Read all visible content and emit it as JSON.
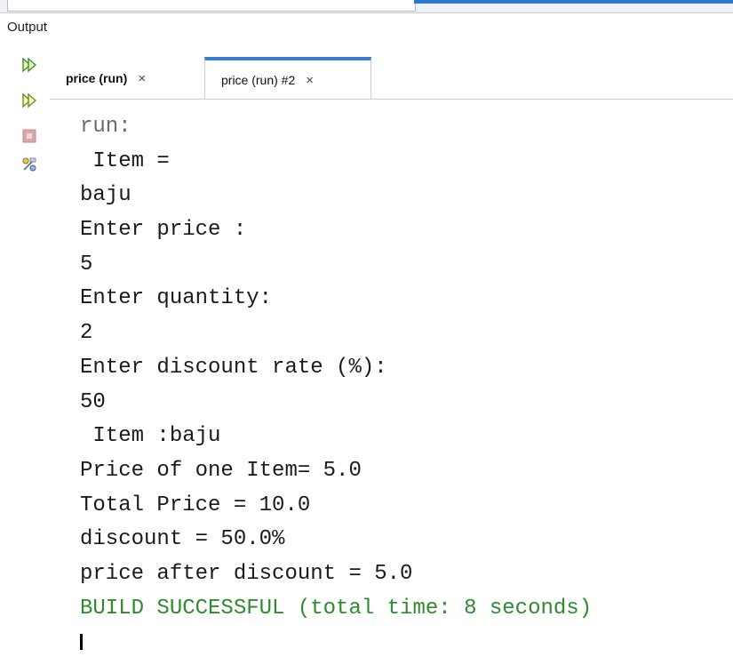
{
  "window": {
    "panel_title": "Output"
  },
  "tabs": [
    {
      "label": "price (run)",
      "close": "×",
      "active": false
    },
    {
      "label": "price (run) #2",
      "close": "×",
      "active": true
    }
  ],
  "toolbar": {
    "rerun_icon": "rerun-icon",
    "rerun_different_icon": "rerun-with-different-params-icon",
    "stop_icon": "stop-icon",
    "settings_icon": "settings-icon",
    "colors": {
      "accent": "#3a7bd5",
      "success": "#2e8b2e"
    }
  },
  "console": {
    "lines": [
      "run:",
      " Item =",
      "baju",
      "Enter price :",
      "5",
      "Enter quantity:",
      "2",
      "Enter discount rate (%):",
      "50",
      " Item :baju",
      "Price of one Item= 5.0",
      "Total Price = 10.0",
      "discount = 50.0%",
      "price after discount = 5.0",
      "BUILD SUCCESSFUL (total time: 8 seconds)"
    ]
  }
}
